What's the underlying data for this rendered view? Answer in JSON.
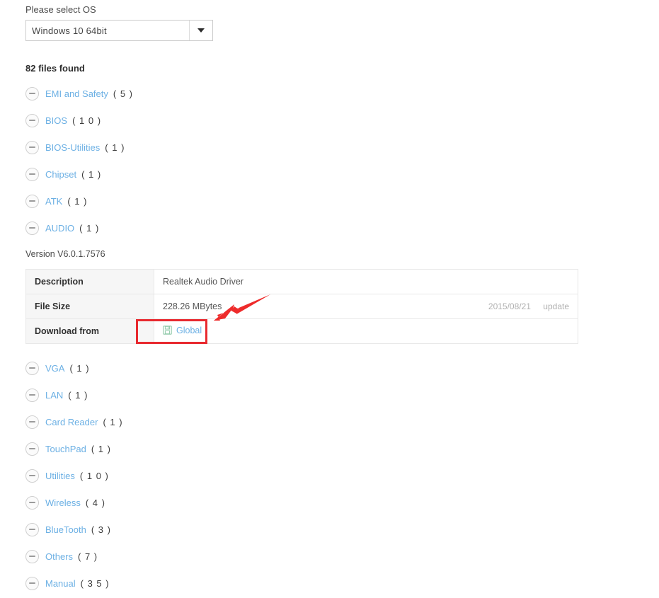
{
  "os_selector": {
    "label": "Please select OS",
    "selected": "Windows 10 64bit",
    "caret_icon": "chevron-down-icon"
  },
  "results": {
    "files_found": "82 files found"
  },
  "categories": [
    {
      "name": "EMI and Safety",
      "count": "( 5 )",
      "icon": "minus-circle-icon"
    },
    {
      "name": "BIOS",
      "count": "( 1 0 )",
      "icon": "minus-circle-icon"
    },
    {
      "name": "BIOS-Utilities",
      "count": "( 1 )",
      "icon": "minus-circle-icon"
    },
    {
      "name": "Chipset",
      "count": "( 1 )",
      "icon": "minus-circle-icon"
    },
    {
      "name": "ATK",
      "count": "( 1 )",
      "icon": "minus-circle-icon"
    },
    {
      "name": "AUDIO",
      "count": "( 1 )",
      "icon": "minus-circle-icon"
    },
    {
      "name": "VGA",
      "count": "( 1 )",
      "icon": "minus-circle-icon"
    },
    {
      "name": "LAN",
      "count": "( 1 )",
      "icon": "minus-circle-icon"
    },
    {
      "name": "Card Reader",
      "count": "( 1 )",
      "icon": "minus-circle-icon"
    },
    {
      "name": "TouchPad",
      "count": "( 1 )",
      "icon": "minus-circle-icon"
    },
    {
      "name": "Utilities",
      "count": "( 1 0 )",
      "icon": "minus-circle-icon"
    },
    {
      "name": "Wireless",
      "count": "( 4 )",
      "icon": "minus-circle-icon"
    },
    {
      "name": "BlueTooth",
      "count": "( 3 )",
      "icon": "minus-circle-icon"
    },
    {
      "name": "Others",
      "count": "( 7 )",
      "icon": "minus-circle-icon"
    },
    {
      "name": "Manual",
      "count": "( 3 5 )",
      "icon": "minus-circle-icon"
    }
  ],
  "driver_detail": {
    "version": "Version V6.0.1.7576",
    "rows": {
      "description_label": "Description",
      "description_value": "Realtek Audio Driver",
      "filesize_label": "File Size",
      "filesize_value": "228.26 MBytes",
      "filesize_date": "2015/08/21",
      "filesize_update": "update",
      "download_label": "Download from",
      "download_link": "Global",
      "download_icon": "floppy-disk-icon"
    }
  },
  "annotations": {
    "highlight_color": "#e8292f",
    "arrow_color": "#ee2b2b",
    "link_color": "#6cb0e4",
    "icon_green": "#8fc9a8"
  }
}
